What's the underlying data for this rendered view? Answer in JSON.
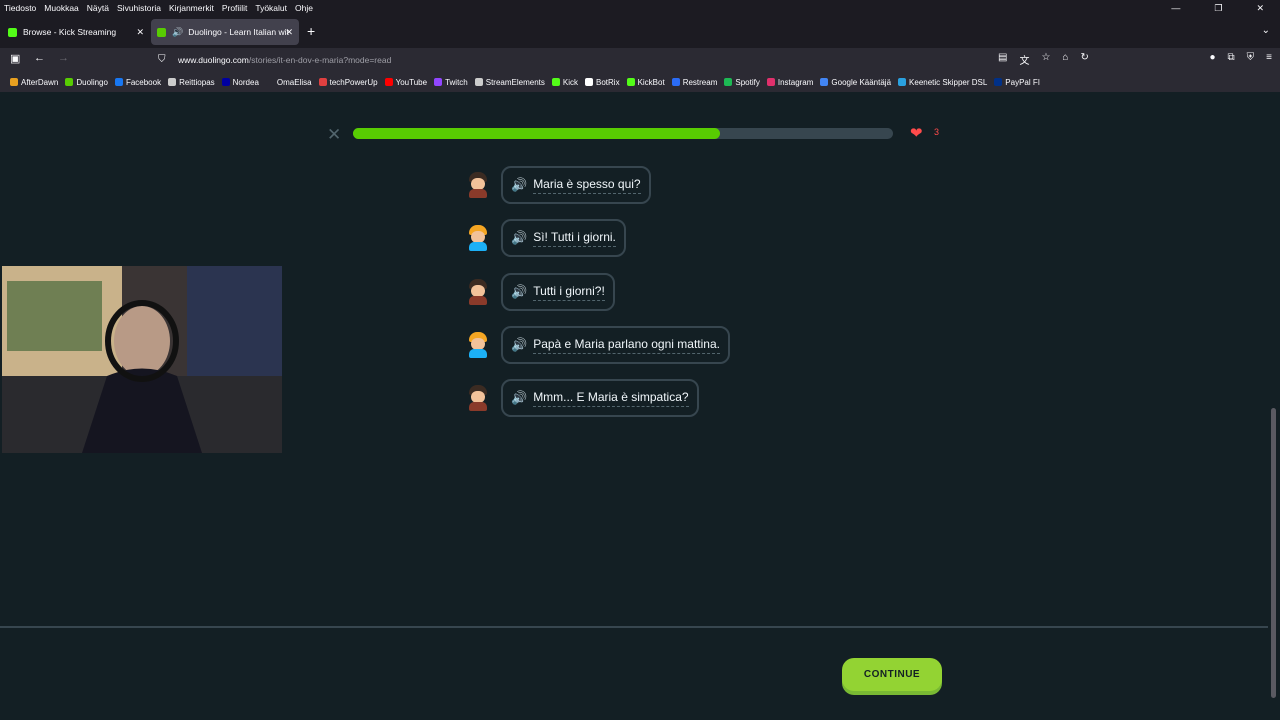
{
  "menu": [
    "Tiedosto",
    "Muokkaa",
    "Näytä",
    "Sivuhistoria",
    "Kirjanmerkit",
    "Profiilit",
    "Työkalut",
    "Ohje"
  ],
  "tabs": [
    {
      "label": "Browse - Kick Streaming",
      "favicon_color": "#53fc18"
    },
    {
      "label": "Duolingo - Learn Italian wit",
      "favicon_color": "#58cc02"
    }
  ],
  "url": {
    "host": "www.duolingo.com",
    "path": "/stories/it-en-dov-e-maria?mode=read"
  },
  "bookmarks": [
    {
      "label": "AfterDawn",
      "color": "#e8a020"
    },
    {
      "label": "Duolingo",
      "color": "#58cc02"
    },
    {
      "label": "Facebook",
      "color": "#1877f2"
    },
    {
      "label": "Reittiopas",
      "color": "#cccccc"
    },
    {
      "label": "Nordea",
      "color": "#0000a0"
    },
    {
      "label": "OmaElisa",
      "color": "#2b2a33"
    },
    {
      "label": "techPowerUp",
      "color": "#e04040"
    },
    {
      "label": "YouTube",
      "color": "#ff0000"
    },
    {
      "label": "Twitch",
      "color": "#9146ff"
    },
    {
      "label": "StreamElements",
      "color": "#cccccc"
    },
    {
      "label": "Kick",
      "color": "#53fc18"
    },
    {
      "label": "BotRix",
      "color": "#ffffff"
    },
    {
      "label": "KickBot",
      "color": "#53fc18"
    },
    {
      "label": "Restream",
      "color": "#2b6cf6"
    },
    {
      "label": "Spotify",
      "color": "#1db954"
    },
    {
      "label": "Instagram",
      "color": "#e1306c"
    },
    {
      "label": "Google Kääntäjä",
      "color": "#4285f4"
    },
    {
      "label": "Keenetic Skipper DSL",
      "color": "#2aa1e0"
    },
    {
      "label": "PayPal FI",
      "color": "#003087"
    }
  ],
  "lesson": {
    "progress": 0.68,
    "hearts": "3",
    "lines": [
      {
        "text": "Maria è spesso qui?",
        "speaker": "a"
      },
      {
        "text": "Sì! Tutti i giorni.",
        "speaker": "b"
      },
      {
        "text": "Tutti i giorni?!",
        "speaker": "a"
      },
      {
        "text": "Papà e Maria parlano ogni mattina.",
        "speaker": "b"
      },
      {
        "text": "Mmm... E Maria è simpatica?",
        "speaker": "a"
      }
    ],
    "continue_label": "CONTINUE"
  },
  "colors": {
    "accent": "#58cc02",
    "speaker": "#1cb0f6",
    "heart": "#ff4b4b"
  }
}
